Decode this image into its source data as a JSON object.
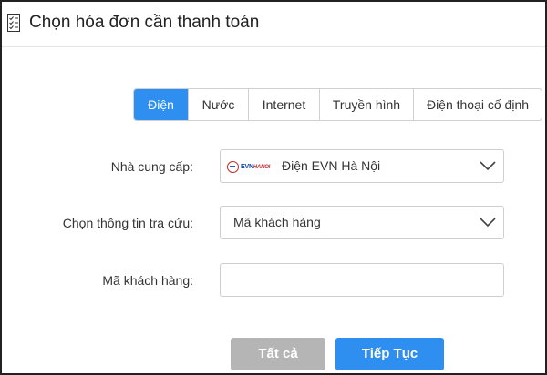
{
  "header": {
    "title": "Chọn hóa đơn cần thanh toán",
    "icon": "checklist-icon"
  },
  "tabs": [
    {
      "label": "Điện",
      "active": true
    },
    {
      "label": "Nước",
      "active": false
    },
    {
      "label": "Internet",
      "active": false
    },
    {
      "label": "Truyền hình",
      "active": false
    },
    {
      "label": "Điện thoại cố định",
      "active": false
    }
  ],
  "form": {
    "provider_label": "Nhà cung cấp:",
    "provider_value": "Điện EVN Hà Nội",
    "provider_logo_text": "EVN",
    "provider_logo_sub": "HANOI",
    "lookup_label": "Chọn thông tin tra cứu:",
    "lookup_value": "Mã khách hàng",
    "customer_code_label": "Mã khách hàng:",
    "customer_code_value": ""
  },
  "buttons": {
    "all_label": "Tất cả",
    "next_label": "Tiếp Tục"
  },
  "colors": {
    "accent": "#2e8ff0",
    "disabled": "#b5b5b5"
  }
}
